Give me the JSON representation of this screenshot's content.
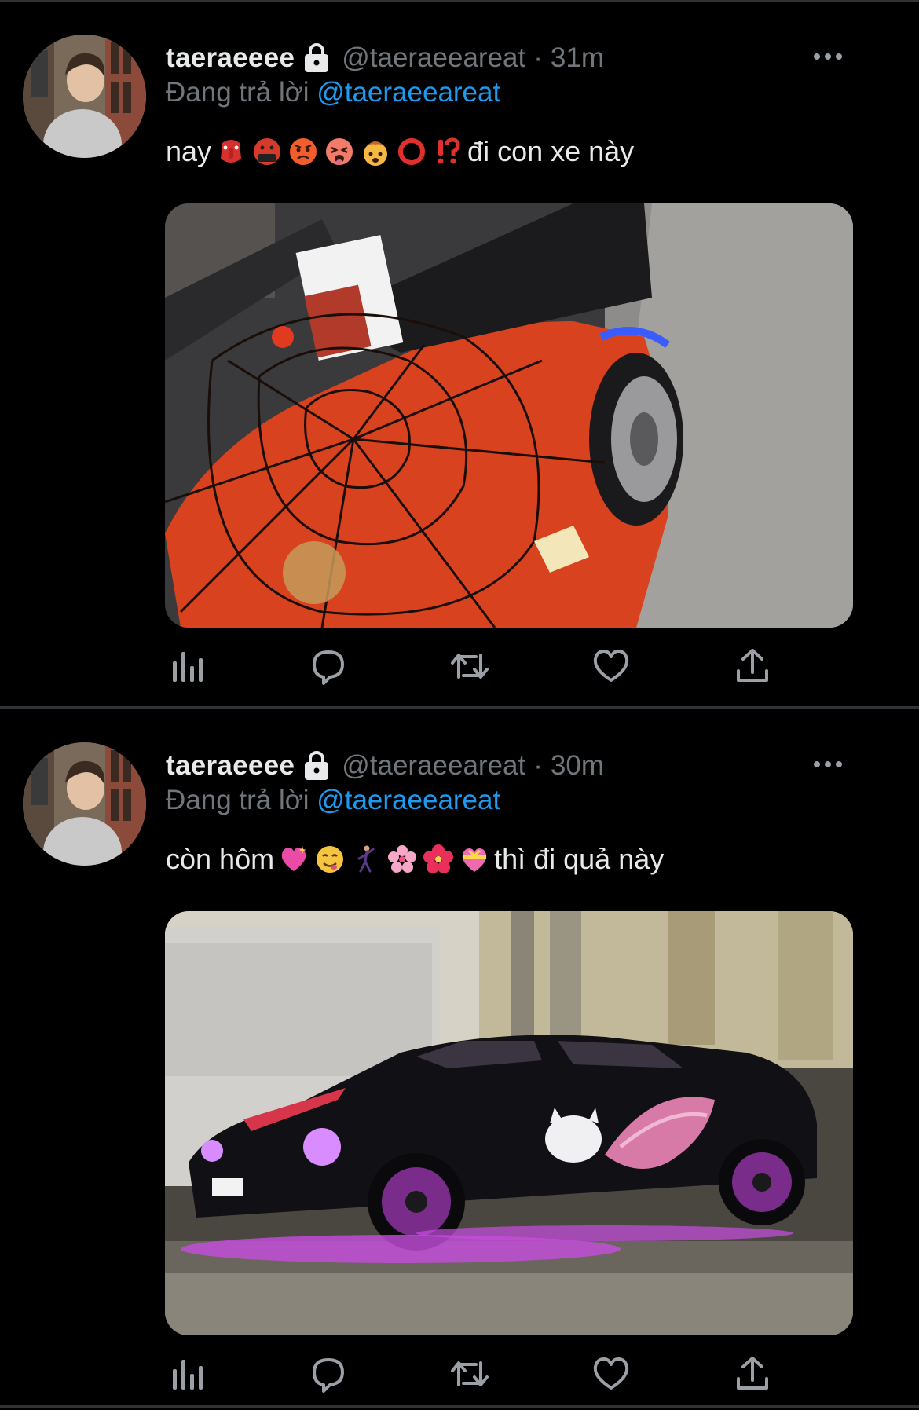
{
  "tweets": [
    {
      "display_name": "taeraeeee",
      "handle": "@taeraeeareat",
      "separator": "·",
      "time": "31m",
      "reply_prefix": "Đang trả lời",
      "reply_mention": "@taeraeeareat",
      "text_before": "nay",
      "text_after": "đi con xe này",
      "emojis": [
        "tengu-icon",
        "cursing-face-icon",
        "angry-face-icon",
        "tired-face-icon",
        "exploding-head-icon",
        "red-circle-icon",
        "interrobang-icon"
      ],
      "media_description_icon": "spiderman-car-photo"
    },
    {
      "display_name": "taeraeeee",
      "handle": "@taeraeeareat",
      "separator": "·",
      "time": "30m",
      "reply_prefix": "Đang trả lời",
      "reply_mention": "@taeraeeareat",
      "text_before": "còn hôm",
      "text_after": "thì đi quả này",
      "emojis": [
        "sparkling-heart-icon",
        "yum-face-icon",
        "dancing-man-icon",
        "cherry-blossom-icon",
        "hibiscus-icon",
        "heart-ribbon-icon"
      ],
      "media_description_icon": "hello-kitty-car-photo"
    }
  ],
  "actions": [
    "views-icon",
    "reply-icon",
    "retweet-icon",
    "like-icon",
    "share-icon"
  ],
  "colors": {
    "background": "#000000",
    "text": "#e7e9ea",
    "secondary": "#71767b",
    "link": "#1d9bf0",
    "divider": "#2f3336"
  }
}
